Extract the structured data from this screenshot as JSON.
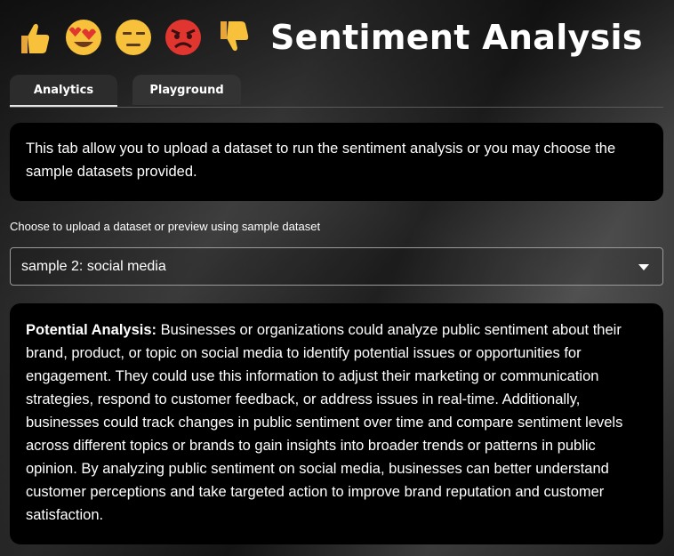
{
  "header": {
    "emojis": [
      "thumbs-up-icon",
      "heart-eyes-icon",
      "neutral-face-icon",
      "angry-face-icon",
      "thumbs-down-icon"
    ],
    "title": "Sentiment Analysis"
  },
  "tabs": [
    {
      "label": "Analytics",
      "active": true
    },
    {
      "label": "Playground",
      "active": false
    }
  ],
  "intro": {
    "text": "This tab allow you to upload a dataset to run the sentiment analysis or you may choose the sample datasets provided."
  },
  "dataset_select": {
    "label": "Choose to upload a dataset or preview using sample dataset",
    "value": "sample 2: social media"
  },
  "analysis": {
    "heading": "Potential Analysis:",
    "body": " Businesses or organizations could analyze public sentiment about their brand, product, or topic on social media to identify potential issues or opportunities for engagement. They could use this information to adjust their marketing or communication strategies, respond to customer feedback, or address issues in real-time. Additionally, businesses could track changes in public sentiment over time and compare sentiment levels across different topics or brands to gain insights into broader trends or patterns in public opinion. By analyzing public sentiment on social media, businesses can better understand customer perceptions and take targeted action to improve brand reputation and customer satisfaction."
  },
  "colors": {
    "emoji_yellow": "#f8c13c",
    "emoji_red": "#e1362f",
    "card_bg": "#000000"
  }
}
